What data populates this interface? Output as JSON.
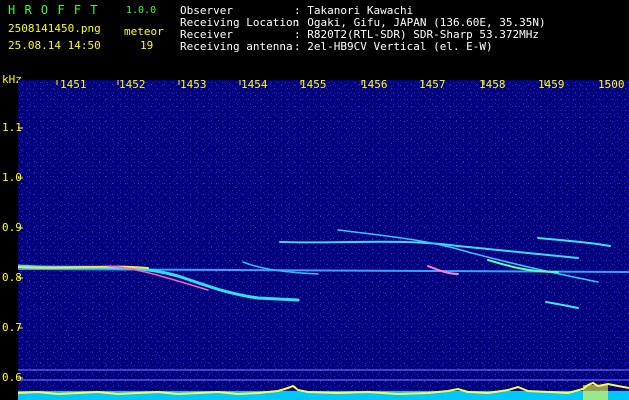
{
  "header": {
    "app_title": "H R O F F T",
    "version": "1.0.0",
    "filename": "2508141450.png",
    "meteor_label": "meteor",
    "meteor_count": "19",
    "datetime": "25.08.14 14:50"
  },
  "info": [
    {
      "key": "Observer",
      "value": ": Takanori Kawachi"
    },
    {
      "key": "Receiving Location",
      "value": ": Ogaki, Gifu, JAPAN (136.60E, 35.35N)"
    },
    {
      "key": "Receiver",
      "value": ": R820T2(RTL-SDR) SDR-Sharp 53.372MHz"
    },
    {
      "key": "Receiving antenna",
      "value": ": 2el-HB9CV Vertical (el. E-W)"
    }
  ],
  "axis": {
    "y_unit": "kHz",
    "x_ticks": [
      "1451",
      "1452",
      "1453",
      "1454",
      "1455",
      "1456",
      "1457",
      "1458",
      "1459",
      "1500"
    ],
    "y_ticks": [
      "1.1",
      "1.0",
      "0.9",
      "0.8",
      "0.7",
      "0.6"
    ]
  },
  "colors": {
    "text": "#ffffff",
    "accent": "#ffff00",
    "title": "#33ff33",
    "background": "#000000",
    "plot_bg": "#00008a",
    "signal": "#00ffff"
  }
}
